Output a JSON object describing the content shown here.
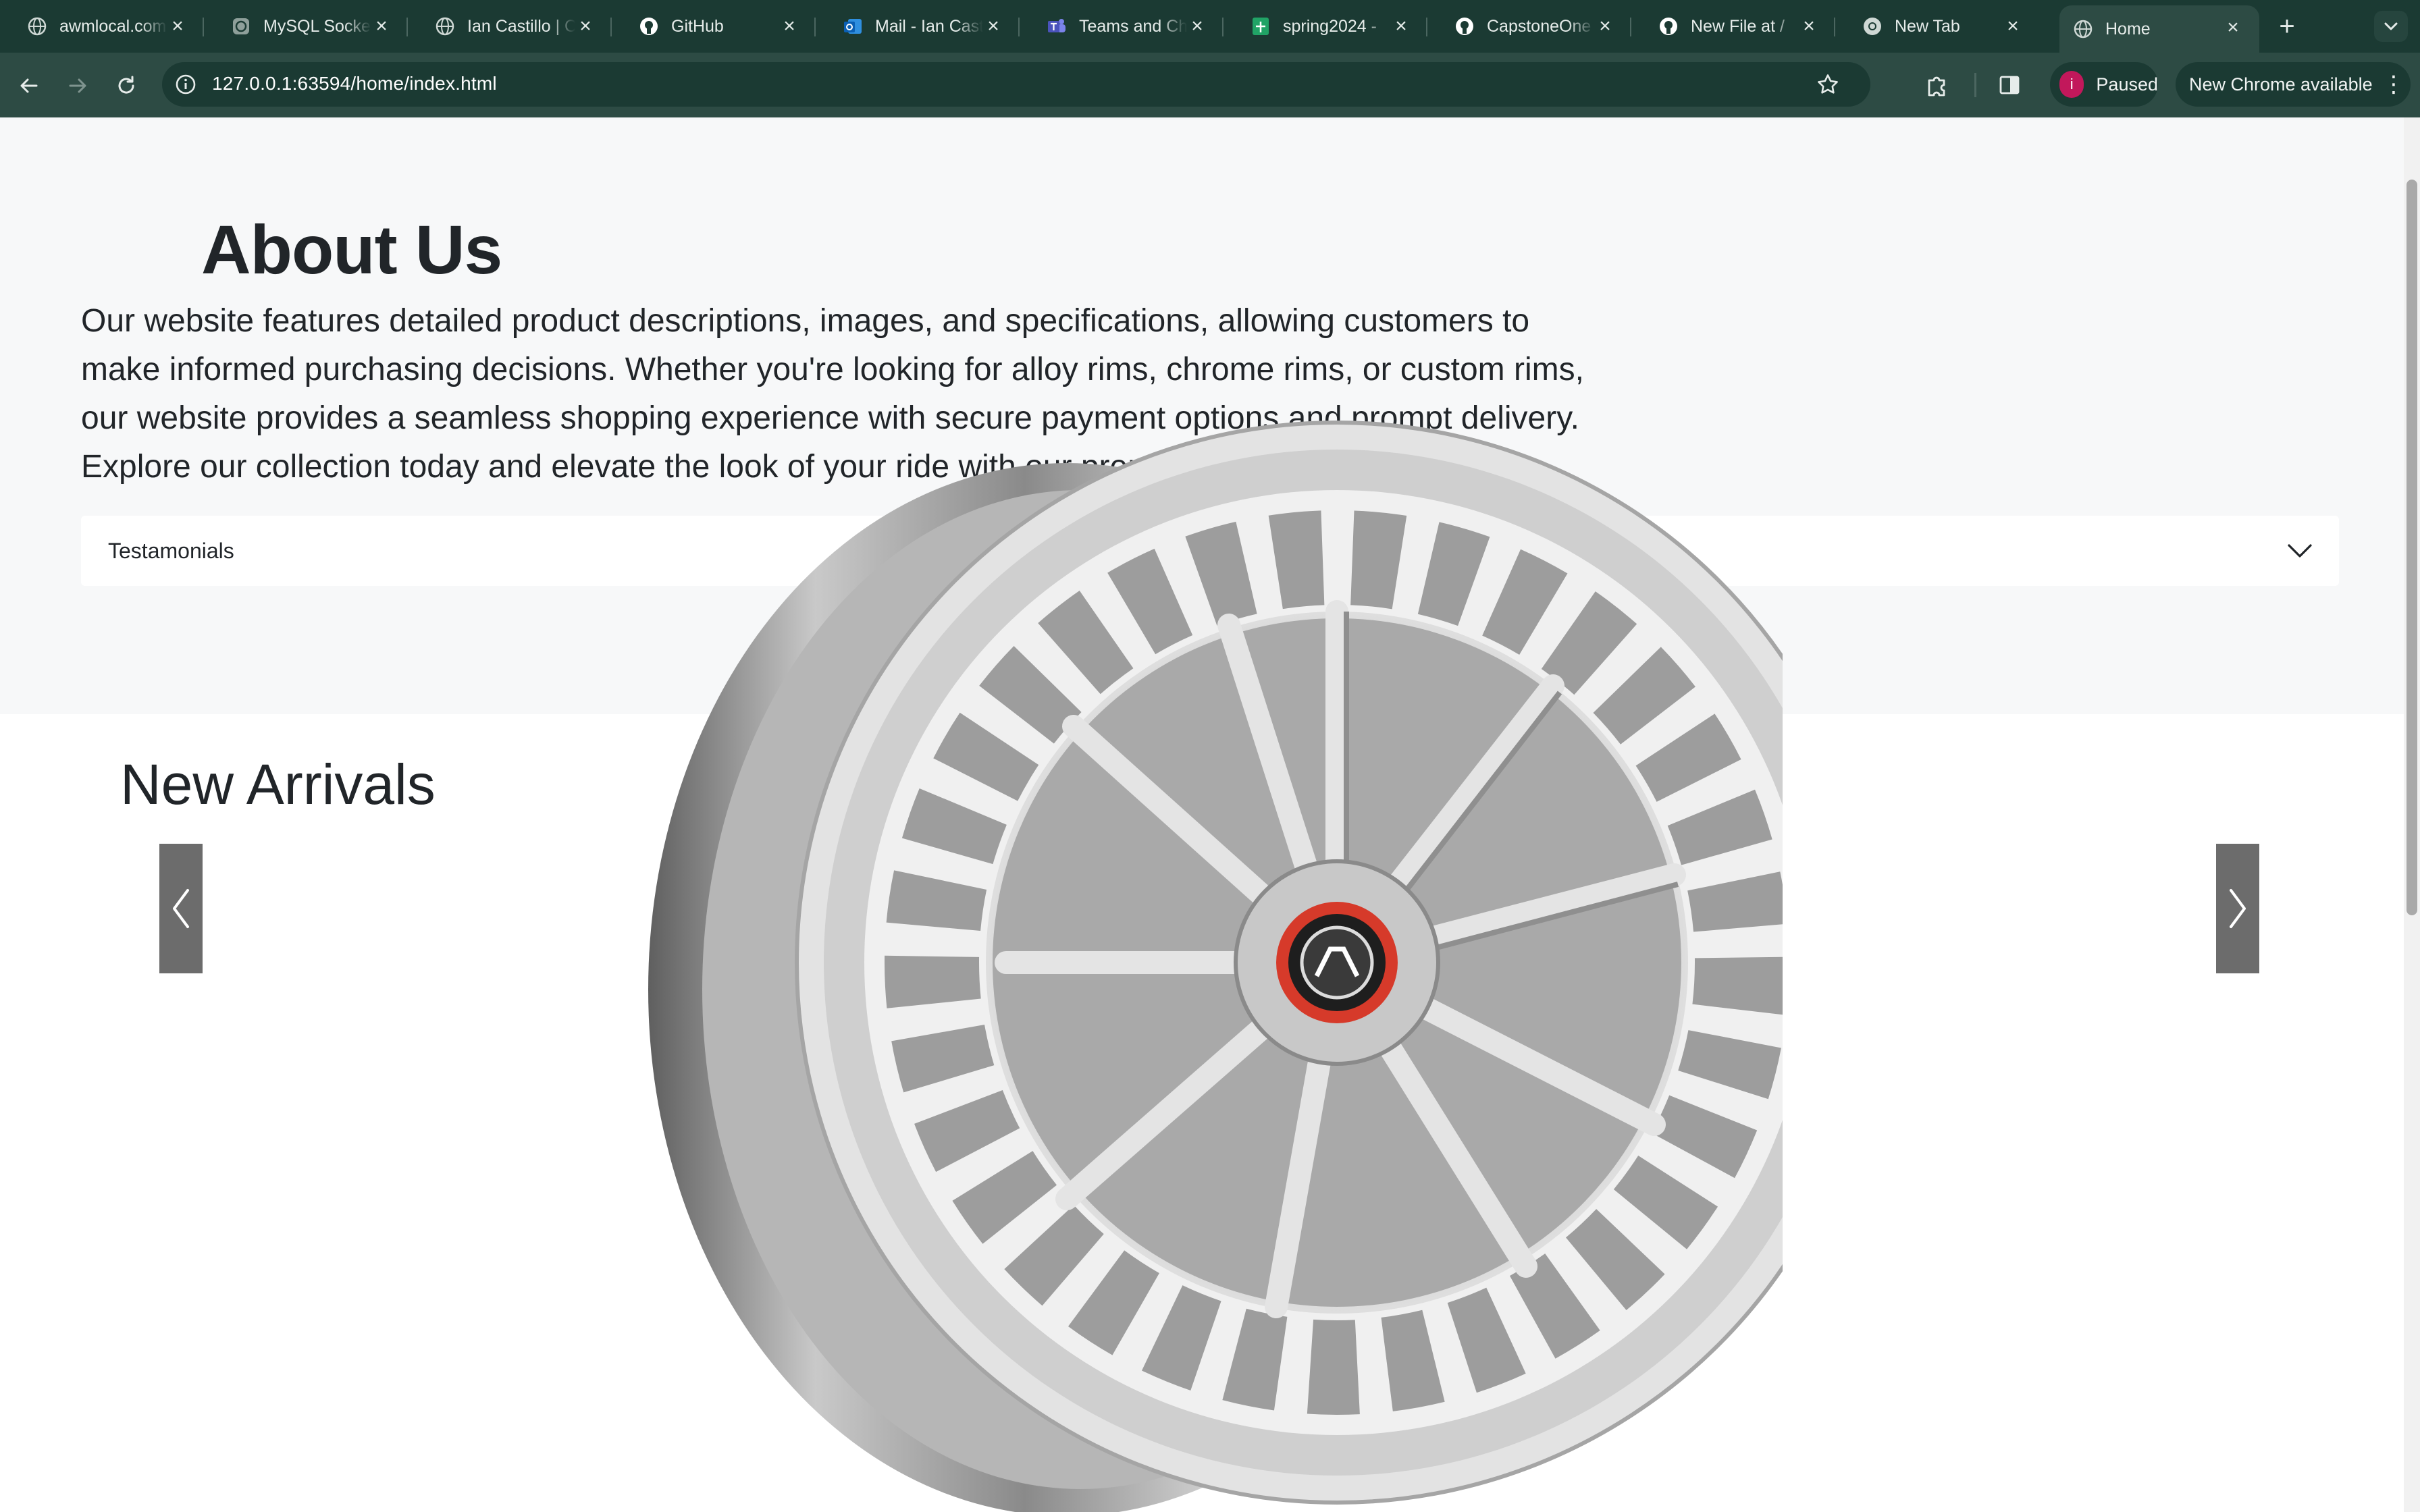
{
  "browser": {
    "tabs": [
      {
        "title": "awmlocal.com",
        "icon": "globe-icon"
      },
      {
        "title": "MySQL Socket",
        "icon": "chatgpt-icon"
      },
      {
        "title": "Ian Castillo | C",
        "icon": "globe-icon"
      },
      {
        "title": "GitHub",
        "icon": "github-icon"
      },
      {
        "title": "Mail - Ian Cast",
        "icon": "outlook-icon"
      },
      {
        "title": "Teams and Ch",
        "icon": "teams-icon"
      },
      {
        "title": "spring2024 -",
        "icon": "sheets-icon"
      },
      {
        "title": "CapstoneOne",
        "icon": "github-icon"
      },
      {
        "title": "New File at /",
        "icon": "github-icon"
      },
      {
        "title": "New Tab",
        "icon": "chrome-icon"
      },
      {
        "title": "Home",
        "icon": "globe-icon"
      }
    ],
    "url": "127.0.0.1:63594/home/index.html",
    "profile_initial": "i",
    "profile_status": "Paused",
    "update_label": "New Chrome available",
    "new_tab_symbol": "+",
    "close_symbol": "×"
  },
  "page": {
    "about_title": "About Us",
    "about_text": "Our website features detailed product descriptions, images, and specifications, allowing customers to make informed purchasing decisions. Whether you're looking for alloy rims, chrome rims, or custom rims, our website provides a seamless shopping experience with secure payment options and prompt delivery. Explore our collection today and elevate the look of your ride with our premium rims.",
    "accordion_label": "Testamonials",
    "arrivals_title": "New Arrivals"
  }
}
